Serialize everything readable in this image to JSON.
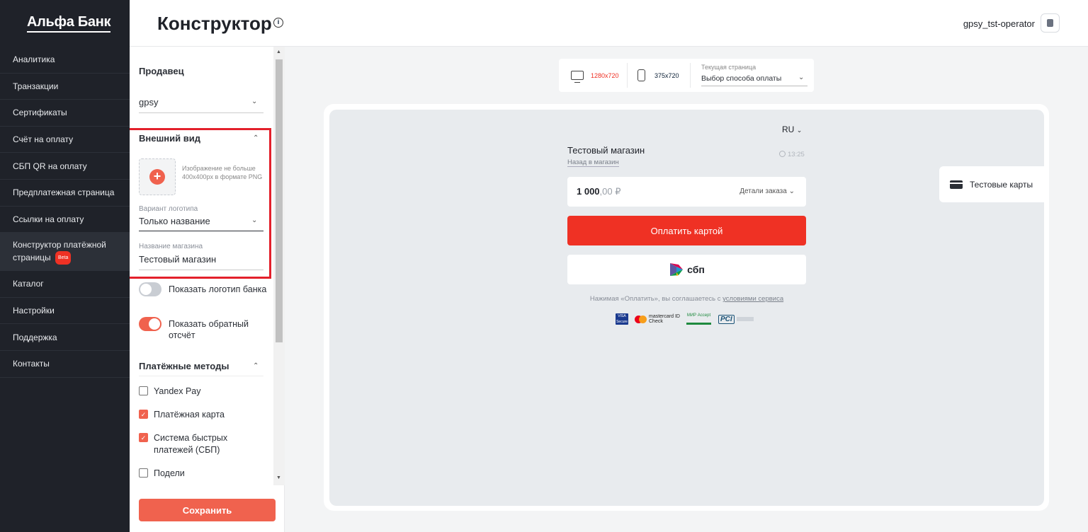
{
  "brand": {
    "logo_text": "Альфа Банк"
  },
  "sidebar": {
    "items": [
      {
        "label": "Аналитика"
      },
      {
        "label": "Транзакции"
      },
      {
        "label": "Сертификаты"
      },
      {
        "label": "Счёт на оплату"
      },
      {
        "label": "СБП QR на оплату"
      },
      {
        "label": "Предплатежная страница"
      },
      {
        "label": "Ссылки на оплату"
      },
      {
        "label": "Конструктор платёжной страницы",
        "badge": "Beta"
      },
      {
        "label": "Каталог"
      },
      {
        "label": "Настройки"
      },
      {
        "label": "Поддержка"
      },
      {
        "label": "Контакты"
      }
    ]
  },
  "header": {
    "title": "Конструктор",
    "info_icon": "i",
    "username": "gpsy_tst-operator",
    "logout_icon": "logout-icon"
  },
  "settings": {
    "seller_title": "Продавец",
    "seller_value": "gpsy",
    "appearance_title": "Внешний вид",
    "upload_hint": "Изображение не больше 400x400px в формате PNG",
    "logo_variant_label": "Вариант логотипа",
    "logo_variant_value": "Только название",
    "shop_name_label": "Название магазина",
    "shop_name_value": "Тестовый магазин",
    "toggles": [
      {
        "label": "Показать логотип банка",
        "on": false
      },
      {
        "label": "Показать обратный отсчёт",
        "on": true
      }
    ],
    "methods_title": "Платёжные методы",
    "methods": [
      {
        "label": "Yandex Pay",
        "checked": false
      },
      {
        "label": "Платёжная карта",
        "checked": true
      },
      {
        "label": "Система быстрых платежей (СБП)",
        "checked": true
      },
      {
        "label": "Подели",
        "checked": false
      }
    ],
    "save_label": "Сохранить"
  },
  "toolbar": {
    "desktop_size": "1280x720",
    "mobile_size": "375x720",
    "current_page_label": "Текущая страница",
    "current_page_value": "Выбор способа оплаты"
  },
  "preview": {
    "lang": "RU",
    "shop_name": "Тестовый магазин",
    "back_link": "Назад в магазин",
    "timer": "13:25",
    "amount_int": "1 000",
    "amount_frac": ",00 ₽",
    "details_label": "Детали заказа",
    "pay_label": "Оплатить картой",
    "sbp_label": "сбп",
    "terms_text": "Нажимая «Оплатить», вы соглашаетесь с ",
    "terms_link": "условиями сервиса",
    "test_cards_label": "Тестовые карты",
    "mc_text": "mastercard ID Check",
    "visa_text": "VISA Secure",
    "mir_text": "МИР Accept",
    "pci_text": "PCI"
  },
  "colors": {
    "accent": "#ef3124",
    "sidebar_bg": "#1f2229",
    "highlight": "#e3202b"
  }
}
